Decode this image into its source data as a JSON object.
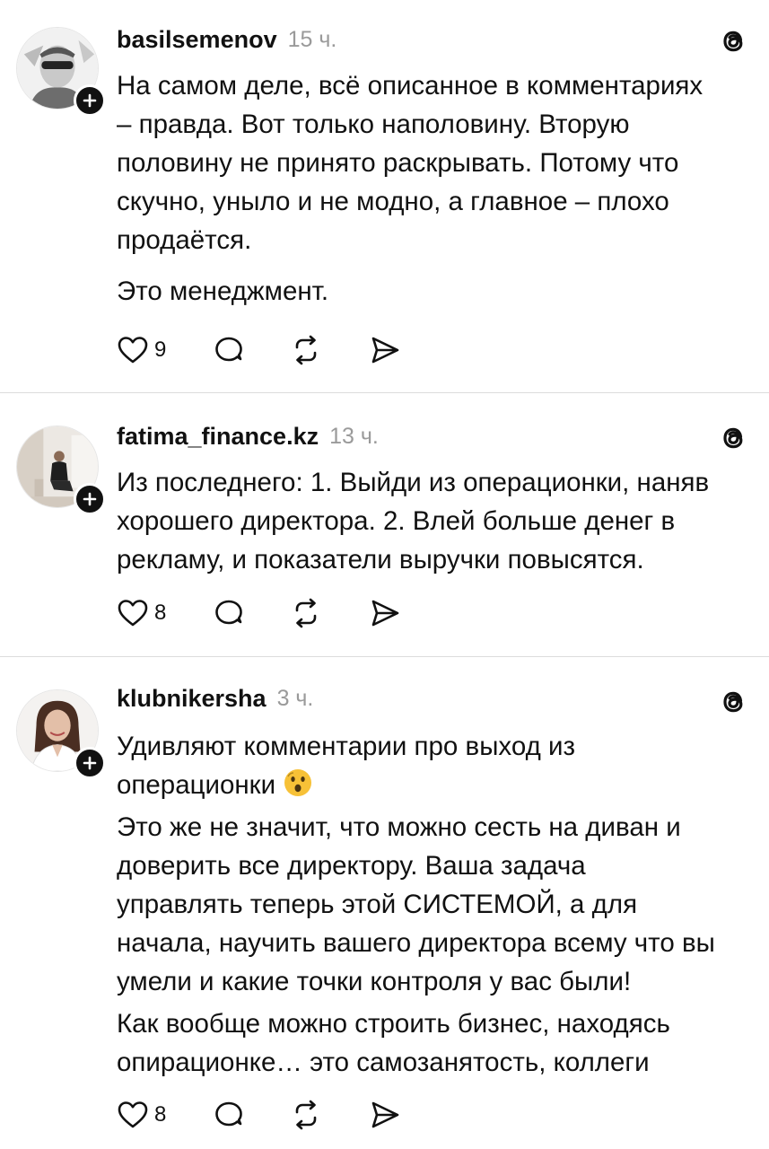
{
  "posts": [
    {
      "username": "basilsemenov",
      "time": "15 ч.",
      "paragraphs": [
        "На самом деле, всё описанное в комментариях\n– правда. Вот только наполовину. Вторую\nполовину не принято раскрывать. Потому что\nскучно, уныло и не модно, а главное – плохо\nпродаётся.",
        "Это менеджмент."
      ],
      "likes": "9",
      "avatar_icon": "man-sunglasses-avatar"
    },
    {
      "username": "fatima_finance.kz",
      "time": "13 ч.",
      "paragraphs": [
        "Из последнего: 1. Выйди из операционки, наняв\nхорошего директора. 2. Влей больше денег в\nрекламу, и показатели выручки повысятся."
      ],
      "likes": "8",
      "avatar_icon": "woman-sitting-avatar"
    },
    {
      "username": "klubnikersha",
      "time": "3 ч.",
      "line1": "Удивляют комментарии про выход из",
      "line2": "операционки",
      "emoji": "surprised-face-emoji",
      "paragraphs": [
        "Это же не значит, что можно сесть на диван и\nдоверить все директору. Ваша задача\nуправлять теперь этой СИСТЕМОЙ, а для\nначала, научить вашего директора всему что вы\nумели и какие точки контроля у вас были!",
        "Как вообще можно строить бизнес, находясь\nопирационке… это самозанятость, коллеги"
      ],
      "likes": "8",
      "avatar_icon": "woman-smiling-avatar"
    }
  ],
  "icons": {
    "like": "heart-icon",
    "comment": "comment-bubble-icon",
    "repost": "repost-icon",
    "share": "send-icon",
    "brand": "threads-logo-icon",
    "follow": "plus-icon"
  }
}
